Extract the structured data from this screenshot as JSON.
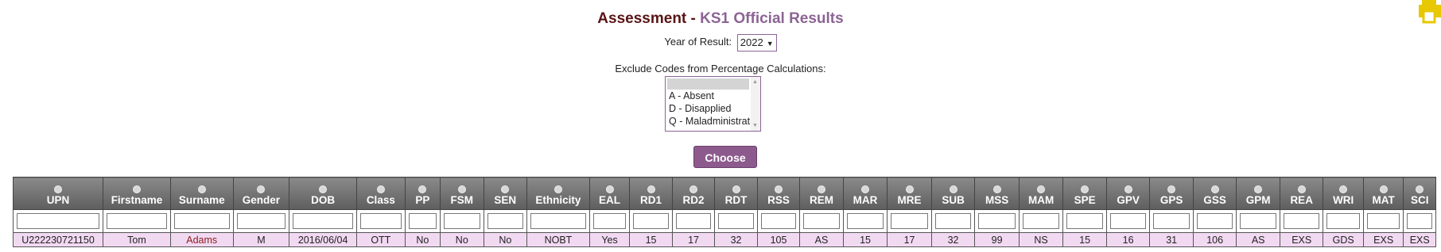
{
  "header": {
    "title_main": "Assessment - ",
    "title_sub": "KS1 Official Results"
  },
  "year": {
    "label": "Year of Result:",
    "selected": "2022"
  },
  "exclude": {
    "label": "Exclude Codes from Percentage Calculations:",
    "options": [
      "",
      "A - Absent",
      "D - Disapplied",
      "Q - Maladministration"
    ]
  },
  "choose_label": "Choose",
  "table": {
    "columns": [
      "UPN",
      "Firstname",
      "Surname",
      "Gender",
      "DOB",
      "Class",
      "PP",
      "FSM",
      "SEN",
      "Ethnicity",
      "EAL",
      "RD1",
      "RD2",
      "RDT",
      "RSS",
      "REM",
      "MAR",
      "MRE",
      "SUB",
      "MSS",
      "MAM",
      "SPE",
      "GPV",
      "GPS",
      "GSS",
      "GPM",
      "REA",
      "WRI",
      "MAT",
      "SCI"
    ],
    "rows": [
      [
        "U222230721150",
        "Tom",
        "Adams",
        "M",
        "2016/06/04",
        "OTT",
        "No",
        "No",
        "No",
        "NOBT",
        "Yes",
        "15",
        "17",
        "32",
        "105",
        "AS",
        "15",
        "17",
        "32",
        "99",
        "NS",
        "15",
        "16",
        "31",
        "106",
        "AS",
        "EXS",
        "GDS",
        "EXS",
        "EXS"
      ]
    ]
  },
  "colors": {
    "title_main": "#5a1414",
    "title_sub": "#8c6494",
    "button": "#8c5a8c",
    "row_bg": "#f2d9f2",
    "printer": "#e8c800"
  }
}
